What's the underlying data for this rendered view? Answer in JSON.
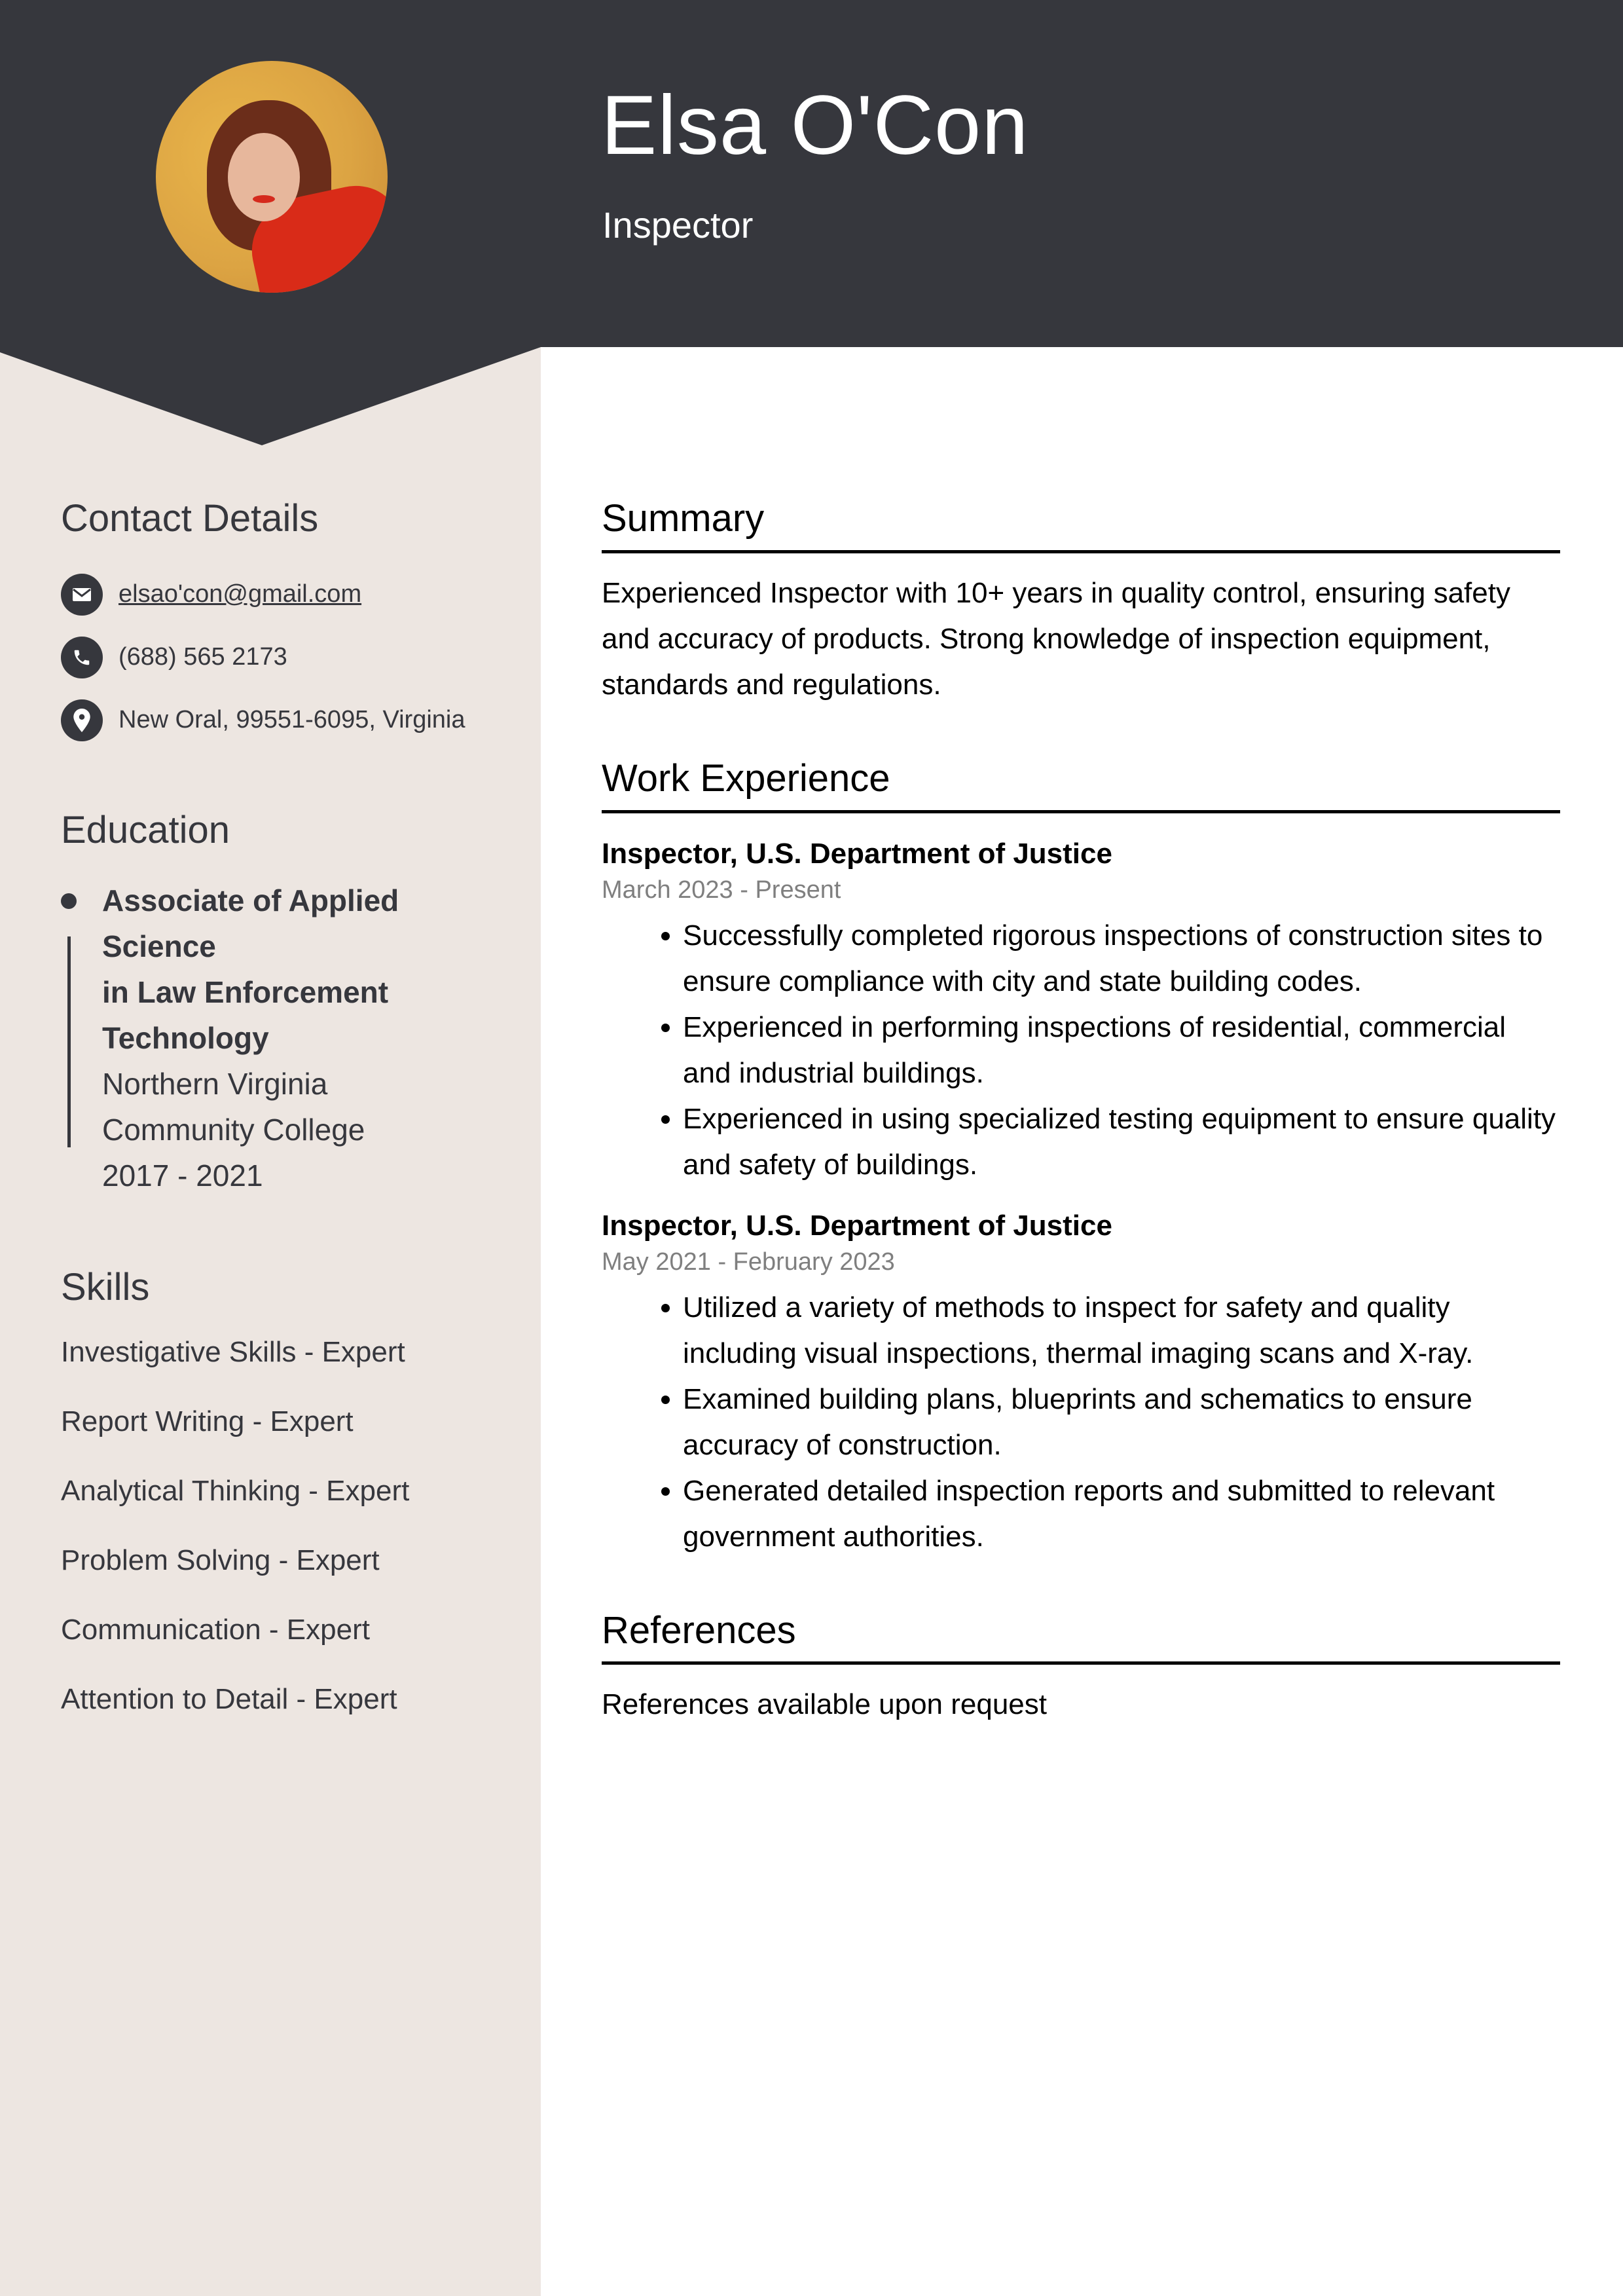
{
  "header": {
    "name": "Elsa O'Con",
    "title": "Inspector"
  },
  "colors": {
    "header_bg": "#36373d",
    "sidebar_bg": "#ede6e1",
    "muted_text": "#7f7f7f"
  },
  "contact": {
    "heading": "Contact Details",
    "items": [
      {
        "icon": "envelope-icon",
        "text": "elsao'con@gmail.com",
        "is_link": true
      },
      {
        "icon": "phone-icon",
        "text": "(688) 565 2173",
        "is_link": false
      },
      {
        "icon": "map-pin-icon",
        "text": "New Oral, 99551-6095, Virginia",
        "is_link": false
      }
    ]
  },
  "education": {
    "heading": "Education",
    "entries": [
      {
        "degree_lines": [
          "Associate of Applied Science",
          "in Law Enforcement",
          "Technology"
        ],
        "school_lines": [
          "Northern Virginia",
          "Community College"
        ],
        "years": "2017 - 2021"
      }
    ]
  },
  "skills": {
    "heading": "Skills",
    "items": [
      "Investigative Skills - Expert",
      "Report Writing - Expert",
      "Analytical Thinking - Expert",
      "Problem Solving - Expert",
      "Communication - Expert",
      "Attention to Detail - Expert"
    ]
  },
  "summary": {
    "heading": "Summary",
    "text": "Experienced Inspector with 10+ years in quality control, ensuring safety and accuracy of products. Strong knowledge of inspection equipment, standards and regulations."
  },
  "work": {
    "heading": "Work Experience",
    "jobs": [
      {
        "title": "Inspector, U.S. Department of Justice",
        "dates": "March 2023 - Present",
        "bullets": [
          "Successfully completed rigorous inspections of construction sites to ensure compliance with city and state building codes.",
          "Experienced in performing inspections of residential, commercial and industrial buildings.",
          "Experienced in using specialized testing equipment to ensure quality and safety of buildings."
        ]
      },
      {
        "title": "Inspector, U.S. Department of Justice",
        "dates": "May 2021 - February 2023",
        "bullets": [
          "Utilized a variety of methods to inspect for safety and quality including visual inspections, thermal imaging scans and X-ray.",
          "Examined building plans, blueprints and schematics to ensure accuracy of construction.",
          "Generated detailed inspection reports and submitted to relevant government authorities."
        ]
      }
    ]
  },
  "references": {
    "heading": "References",
    "text": "References available upon request"
  }
}
